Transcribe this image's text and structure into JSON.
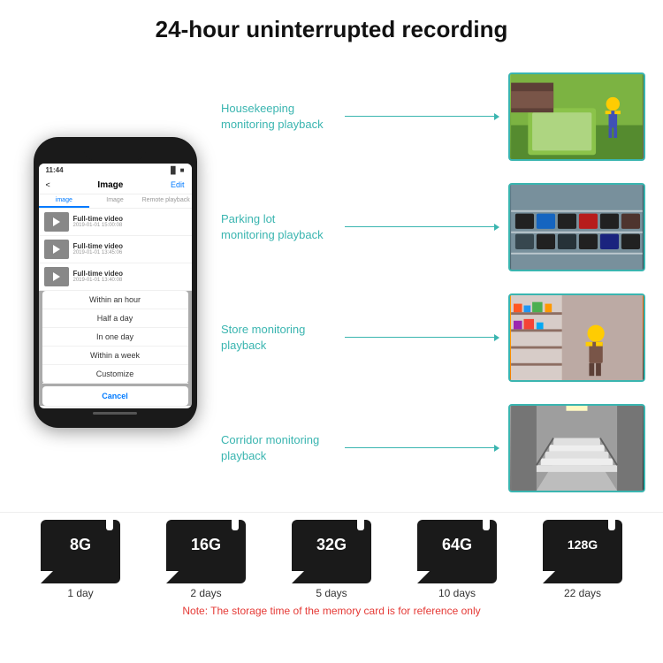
{
  "header": {
    "title": "24-hour uninterrupted recording"
  },
  "phone": {
    "time": "11:44",
    "nav_back": "<",
    "nav_title": "Image",
    "nav_edit": "Edit",
    "tab_image": "image",
    "tab_image2": "Image",
    "tab_remote": "Remote playback",
    "video_items": [
      {
        "title": "Full-time video",
        "date": "2019-01-01 15:00:08"
      },
      {
        "title": "Full-time video",
        "date": "2019-01-01 13:45:06"
      },
      {
        "title": "Full-time video",
        "date": "2019-01-01 13:40:08"
      }
    ],
    "dropdown_items": [
      "Within an hour",
      "Half a day",
      "In one day",
      "Within a week",
      "Customize"
    ],
    "cancel_label": "Cancel"
  },
  "monitoring": [
    {
      "label": "Housekeeping\nmonitoring playback",
      "photo_type": "housekeeping"
    },
    {
      "label": "Parking lot\nmonitoring playback",
      "photo_type": "parking"
    },
    {
      "label": "Store monitoring\nplayback",
      "photo_type": "store"
    },
    {
      "label": "Corridor monitoring\nplayback",
      "photo_type": "corridor"
    }
  ],
  "sd_cards": [
    {
      "size": "8G",
      "days": "1 day"
    },
    {
      "size": "16G",
      "days": "2 days"
    },
    {
      "size": "32G",
      "days": "5 days"
    },
    {
      "size": "64G",
      "days": "10 days"
    },
    {
      "size": "128G",
      "days": "22 days"
    }
  ],
  "note": "Note: The storage time of the memory card is for reference only",
  "colors": {
    "accent": "#3ab5b0",
    "note_red": "#e53935"
  }
}
